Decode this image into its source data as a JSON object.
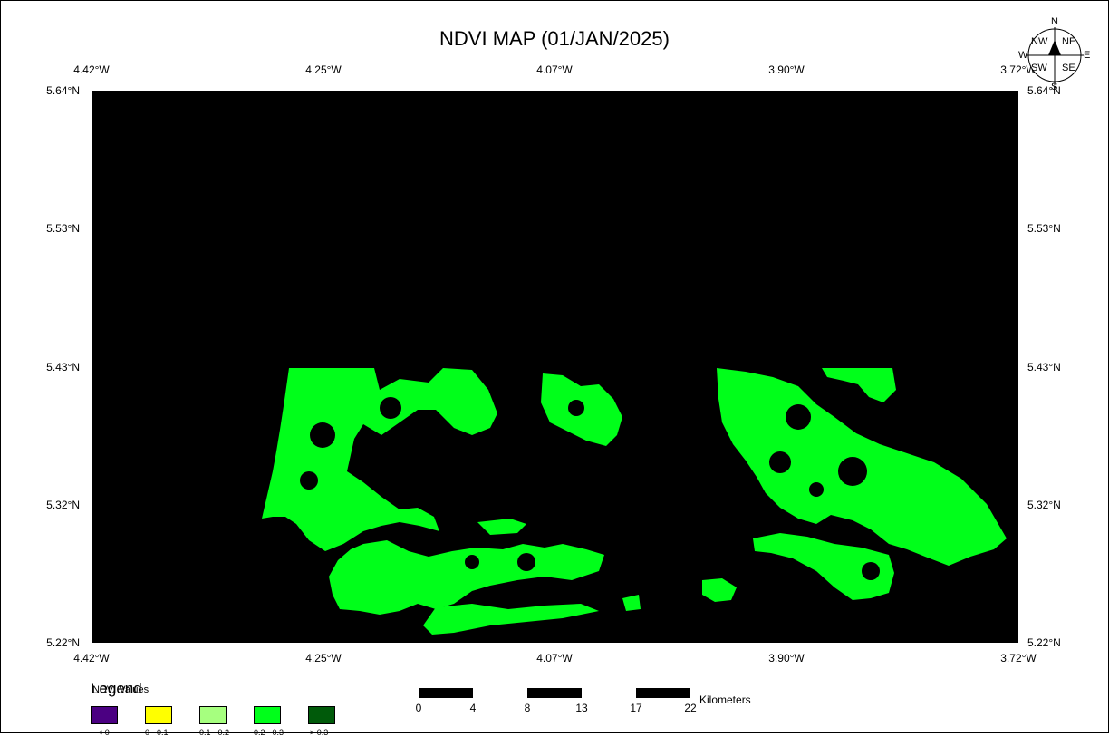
{
  "title": "NDVI MAP (01/JAN/2025)",
  "longitude_ticks": [
    "4.42°W",
    "4.25°W",
    "4.07°W",
    "3.90°W",
    "3.72°W"
  ],
  "latitude_ticks": [
    "5.64°N",
    "5.53°N",
    "5.43°N",
    "5.32°N",
    "5.22°N"
  ],
  "compass": {
    "n": "N",
    "ne": "NE",
    "e": "E",
    "se": "SE",
    "s": "S",
    "sw": "SW",
    "w": "W",
    "nw": "NW"
  },
  "legend": {
    "title": "Legend",
    "subtitle": "NDVI Values",
    "classes": [
      {
        "color": "#4b0082",
        "label": "< 0"
      },
      {
        "color": "#ffff00",
        "label": "0 - 0.1"
      },
      {
        "color": "#a6ff7f",
        "label": "0.1 - 0.2"
      },
      {
        "color": "#00ff1a",
        "label": "0.2 - 0.3"
      },
      {
        "color": "#005a0a",
        "label": "> 0.3"
      }
    ]
  },
  "scale_bar": {
    "labels": [
      "0",
      "4",
      "8",
      "13",
      "17",
      "22"
    ],
    "unit": "Kilometers"
  },
  "colors": {
    "background": "#000000",
    "vegetation": "#00ff1a"
  }
}
